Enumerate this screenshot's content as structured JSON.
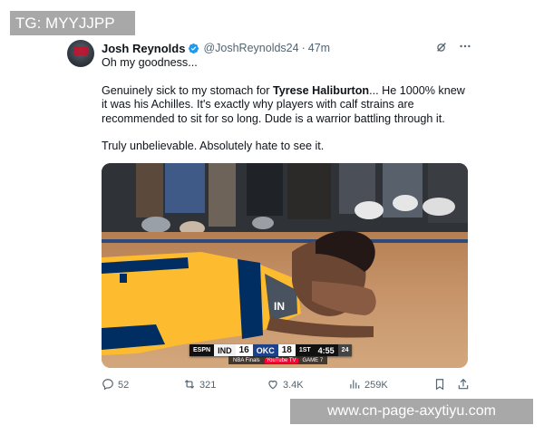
{
  "watermark_top": "TG: MYYJJPP",
  "watermark_bottom": "www.cn-page-axytiyu.com",
  "post": {
    "author_name": "Josh Reynolds",
    "handle": "@JoshReynolds24",
    "separator": "·",
    "time": "47m",
    "text": {
      "line1": "Oh my goodness...",
      "para2_before": "Genuinely sick to my stomach for ",
      "para2_mention": "Tyrese Haliburton",
      "para2_after": "... He 1000% knew it was his Achilles. It's exactly why players with calf strains are recommended to sit for so long. Dude is a warrior battling through it.",
      "para3": "Truly unbelievable. Absolutely hate to see it."
    },
    "scorebug": {
      "network": "ESPN",
      "team1": "IND",
      "score1": "16",
      "team2": "OKC",
      "score2": "18",
      "quarter": "1ST",
      "clock": "4:55",
      "shot_clock": "24",
      "sub_left": "NBA Finals",
      "sub_mid": "YouTube TV",
      "sub_right": "GAME 7"
    },
    "actions": {
      "replies": "52",
      "reposts": "321",
      "likes": "3.4K",
      "views": "259K"
    },
    "icons": {
      "verified": "verified-badge-icon",
      "grok": "grok-icon",
      "more": "more-icon",
      "reply": "reply-icon",
      "repost": "repost-icon",
      "like": "heart-icon",
      "views": "views-icon",
      "bookmark": "bookmark-icon",
      "share": "share-icon"
    },
    "colors": {
      "verified": "#1d9bf0",
      "text": "#0f1419",
      "muted": "#536471",
      "pacers_yellow": "#fdbb30",
      "pacers_navy": "#002d62"
    }
  }
}
